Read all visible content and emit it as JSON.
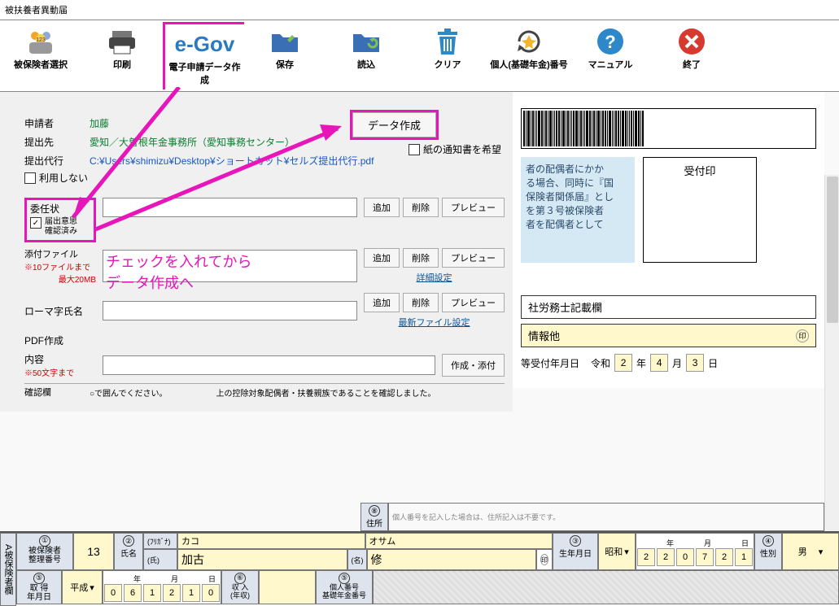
{
  "window": {
    "title": "被扶養者異動届"
  },
  "toolbar": [
    {
      "name": "insured-select",
      "label": "被保険者選択"
    },
    {
      "name": "print",
      "label": "印刷"
    },
    {
      "name": "egov-create",
      "label": "電子申請データ作成",
      "logo": "e-Gov"
    },
    {
      "name": "save",
      "label": "保存"
    },
    {
      "name": "load",
      "label": "読込"
    },
    {
      "name": "clear",
      "label": "クリア"
    },
    {
      "name": "pension-number",
      "label": "個人(基礎年金)番号"
    },
    {
      "name": "manual",
      "label": "マニュアル"
    },
    {
      "name": "close",
      "label": "終了"
    }
  ],
  "form": {
    "applicant_label": "申請者",
    "applicant_value": "加藤",
    "dest_label": "提出先",
    "dest_value": "愛知／大曽根年金事務所（愛知事務センター）",
    "proxy_label": "提出代行",
    "proxy_path": "C:¥Users¥shimizu¥Desktop¥ショートカット¥セルズ提出代行.pdf",
    "use_none": "利用しない",
    "consent_title": "委任状",
    "consent_check": "届出意思\n確認済み",
    "data_create_btn": "データ作成",
    "paper_notice": "紙の通知書を希望",
    "attach_label": "添付ファイル",
    "attach_note1": "※10ファイルまで",
    "attach_note2": "最大20MB",
    "romaji_label": "ローマ字氏名",
    "pdf_label": "PDF作成",
    "content_label": "内容",
    "content_note": "※50文字まで",
    "add_btn": "追加",
    "del_btn": "削除",
    "preview_btn": "プレビュー",
    "detail_link": "詳細設定",
    "latest_link": "最新ファイル設定",
    "create_attach_btn": "作成・添付",
    "confirm_label": "確認欄",
    "confirm_text": "上の控除対象配偶者・扶養親族であることを確認しました。"
  },
  "annotation": {
    "text1": "チェックを入れてから",
    "text2": "データ作成へ"
  },
  "right": {
    "stamp": "受付印",
    "blue1": "者の配偶者にかか",
    "blue2": "る場合、同時に『国",
    "blue3": "保険者関係届』とし",
    "blue4": "を第３号被保険者",
    "blue5": "者を配偶者として",
    "sr_label": "社労務士記載欄",
    "info_label": "情報他",
    "receipt_date_label": "等受付年月日",
    "era": "令和",
    "year": "2",
    "y_unit": "年",
    "month": "4",
    "m_unit": "月",
    "day": "3",
    "d_unit": "日"
  },
  "bottom": {
    "side": "A被保険者欄",
    "num1": "①",
    "insured_no_label": "被保険者\n整理番号",
    "insured_no": "13",
    "num2": "②",
    "name_label": "氏名",
    "furigana_label": "(ﾌﾘｶﾞﾅ)",
    "kana_sur": "カコ",
    "kana_given": "オサム",
    "shi_label": "(氏)",
    "na_label": "(名)",
    "sur": "加古",
    "given": "修",
    "num3": "③",
    "dob_label": "生年月日",
    "era2": "昭和",
    "dob_digits": [
      "2",
      "2",
      "0",
      "7",
      "2",
      "1"
    ],
    "num4": "④",
    "sex_label": "性別",
    "sex": "男",
    "num5": "⑤",
    "acq_label": "取 得\n年月日",
    "era3": "平成",
    "acq_digits": [
      "0",
      "6",
      "1",
      "2",
      "1",
      "0"
    ],
    "y": "年",
    "m": "月",
    "d": "日",
    "num6": "⑥",
    "income_label": "収 入\n(年収)",
    "num7": "⑤",
    "mynumber_label": "個人番号\n基礎年金番号",
    "num8": "⑧",
    "addr_label": "住所",
    "addr_note": "個人番号を記入した場合は、住所記入は不要です。"
  }
}
